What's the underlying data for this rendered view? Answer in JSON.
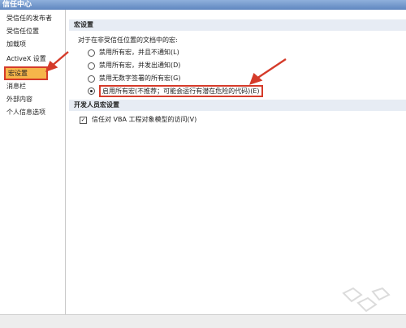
{
  "window": {
    "title": "信任中心"
  },
  "sidebar": {
    "items": [
      {
        "label": "受信任的发布者",
        "selected": false
      },
      {
        "label": "受信任位置",
        "selected": false
      },
      {
        "label": "加载项",
        "selected": false
      },
      {
        "label": "ActiveX 设置",
        "selected": false
      },
      {
        "label": "宏设置",
        "selected": true
      },
      {
        "label": "消息栏",
        "selected": false
      },
      {
        "label": "外部内容",
        "selected": false
      },
      {
        "label": "个人信息选项",
        "selected": false
      }
    ]
  },
  "macro_settings": {
    "header": "宏设置",
    "description": "对于在非受信任位置的文档中的宏:",
    "options": [
      {
        "label": "禁用所有宏，并且不通知(L)",
        "checked": false
      },
      {
        "label": "禁用所有宏，并发出通知(D)",
        "checked": false
      },
      {
        "label": "禁用无数字签署的所有宏(G)",
        "checked": false
      },
      {
        "label": "启用所有宏(不推荐；可能会运行有潜在危险的代码)(E)",
        "checked": true
      }
    ]
  },
  "developer_macro_settings": {
    "header": "开发人员宏设置",
    "checkbox": {
      "label": "信任对 VBA 工程对象模型的访问(V)",
      "checked": true,
      "mark": "✓"
    }
  },
  "colors": {
    "highlight_border": "#d53b2a",
    "selected_fill": "#f6b54a",
    "section_header_bg": "#e7ecf4"
  }
}
